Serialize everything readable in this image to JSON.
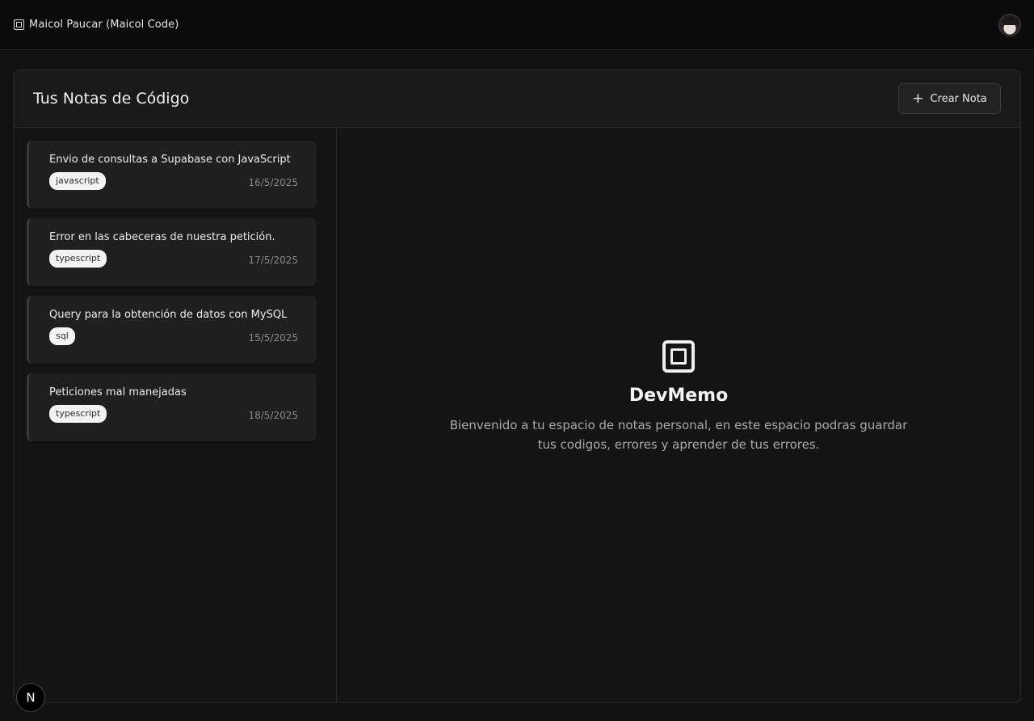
{
  "topbar": {
    "brand_name": "Maicol Paucar (Maicol Code)",
    "brand_icon": "square-logo-icon",
    "avatar": "user-avatar"
  },
  "panel": {
    "title": "Tus Notas de Código",
    "create_button": "Crear Nota"
  },
  "notes": [
    {
      "title": "Envio de consultas a Supabase con JavaScript",
      "tag": "javascript",
      "date": "16/5/2025"
    },
    {
      "title": "Error en las cabeceras de nuestra petición.",
      "tag": "typescript",
      "date": "17/5/2025"
    },
    {
      "title": "Query para la obtención de datos con MySQL",
      "tag": "sql",
      "date": "15/5/2025"
    },
    {
      "title": "Peticiones mal manejadas",
      "tag": "typescript",
      "date": "18/5/2025"
    }
  ],
  "welcome": {
    "title": "DevMemo",
    "description": "Bienvenido a tu espacio de notas personal, en este espacio podras guardar tus codigos, errores y aprender de tus errores."
  },
  "dev_badge": {
    "label": "N"
  }
}
